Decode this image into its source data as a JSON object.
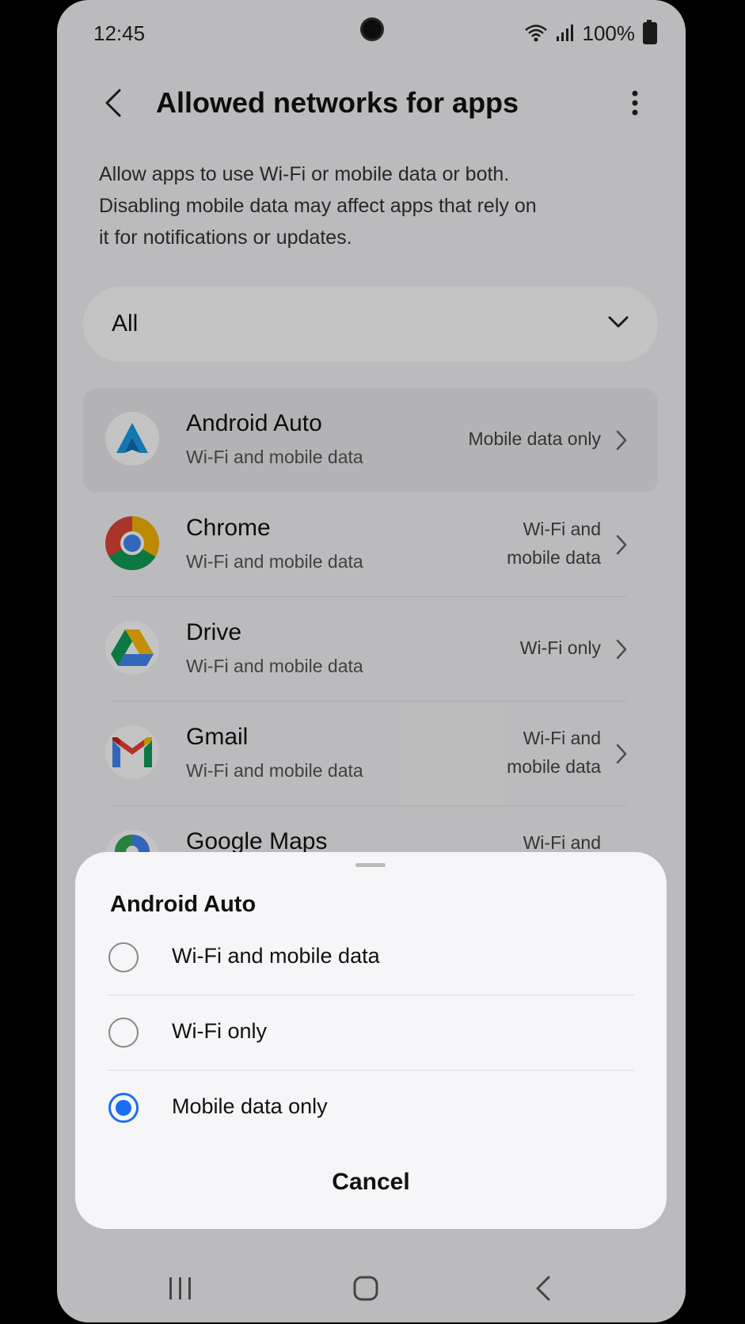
{
  "status": {
    "time": "12:45",
    "battery": "100%"
  },
  "appbar": {
    "title": "Allowed networks for apps"
  },
  "description": "Allow apps to use Wi-Fi or mobile data or both. Disabling mobile data may affect apps that rely on it for notifications or updates.",
  "filter": {
    "selected": "All"
  },
  "apps": [
    {
      "name": "Android Auto",
      "sub": "Wi-Fi and mobile data",
      "value": "Mobile data only"
    },
    {
      "name": "Chrome",
      "sub": "Wi-Fi and mobile data",
      "value": "Wi-Fi and mobile data"
    },
    {
      "name": "Drive",
      "sub": "Wi-Fi and mobile data",
      "value": "Wi-Fi only"
    },
    {
      "name": "Gmail",
      "sub": "Wi-Fi and mobile data",
      "value": "Wi-Fi and mobile data"
    },
    {
      "name": "Google Maps",
      "sub": "",
      "value": "Wi-Fi and"
    }
  ],
  "sheet": {
    "title": "Android Auto",
    "options": [
      "Wi-Fi and mobile data",
      "Wi-Fi only",
      "Mobile data only"
    ],
    "selected_index": 2,
    "cancel_label": "Cancel"
  },
  "colors": {
    "accent": "#1a6ef0"
  }
}
